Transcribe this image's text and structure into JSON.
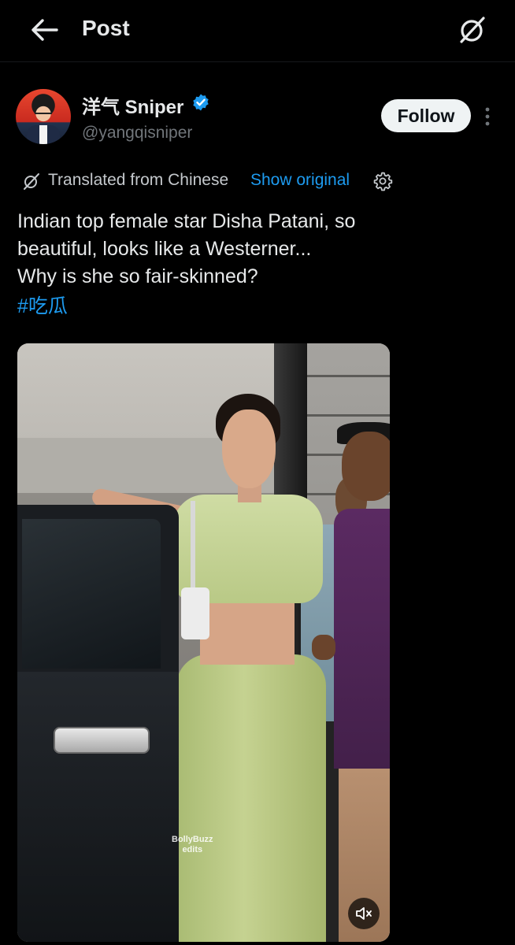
{
  "header": {
    "title": "Post",
    "back_icon": "arrow-left-icon",
    "grok_icon": "grok-icon"
  },
  "author": {
    "display_name": "洋气 Sniper",
    "handle": "@yangqisniper",
    "verified": true,
    "verified_color": "#1d9bf0"
  },
  "actions": {
    "follow_label": "Follow",
    "more_icon": "more-vertical-icon"
  },
  "translation": {
    "label": "Translated from Chinese",
    "show_original": "Show original",
    "settings_icon": "gear-icon"
  },
  "post": {
    "lines": [
      "Indian top female star Disha Patani, so",
      "beautiful, looks like a Westerner...",
      "Why is she so fair-skinned?"
    ],
    "hashtag": "#吃瓜"
  },
  "media": {
    "type": "video",
    "watermark_line1": "BollyBuzz",
    "watermark_line2": "edits",
    "mute_icon": "volume-muted-icon"
  },
  "colors": {
    "background": "#000000",
    "text": "#e7e9ea",
    "secondary_text": "#71767b",
    "link": "#1d9bf0",
    "follow_bg": "#eff3f4"
  }
}
